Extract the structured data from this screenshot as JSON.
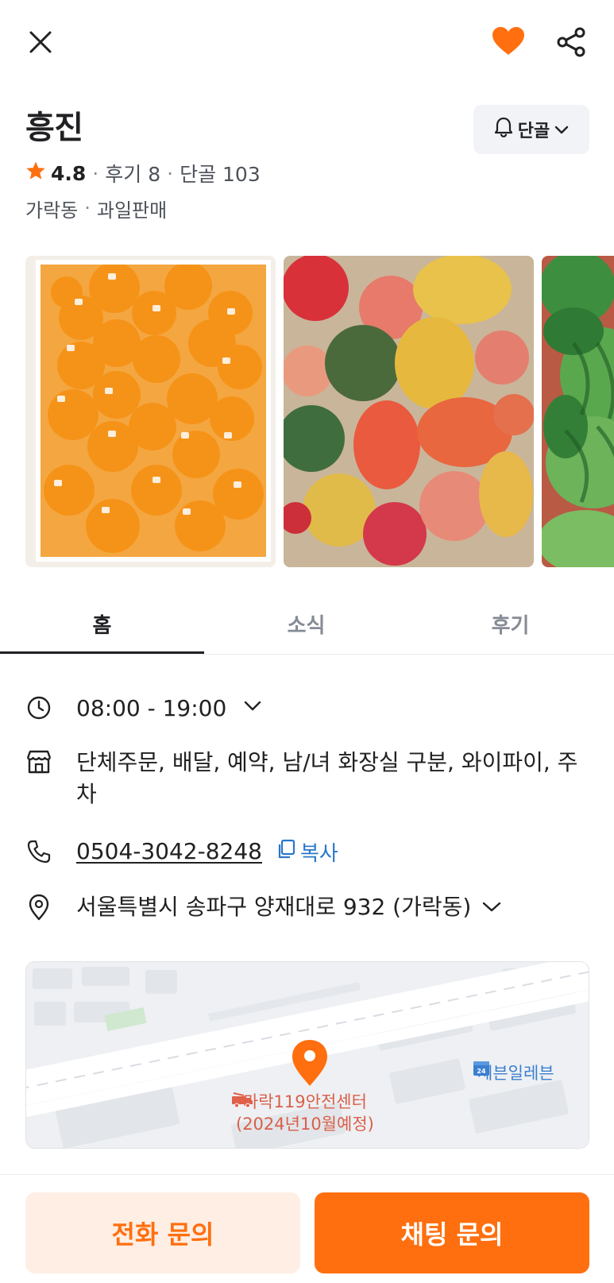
{
  "header": {
    "close_icon": "close-icon",
    "favorite_icon": "heart-icon",
    "share_icon": "share-icon",
    "favorite_color": "#FF6F0F"
  },
  "store": {
    "name": "흥진",
    "regular_button_label": "단골",
    "rating": "4.8",
    "reviews_label": "후기 8",
    "regulars_label": "단골 103",
    "location": "가락동",
    "category": "과일판매"
  },
  "photos": [
    {
      "subject": "boxed tangerines",
      "icon": "photo"
    },
    {
      "subject": "apples and pears",
      "icon": "photo"
    },
    {
      "subject": "watermelons",
      "icon": "photo"
    }
  ],
  "tabs": [
    {
      "label": "홈",
      "active": true
    },
    {
      "label": "소식",
      "active": false
    },
    {
      "label": "후기",
      "active": false
    }
  ],
  "info": {
    "hours": "08:00 - 19:00",
    "amenities": "단체주문, 배달, 예약, 남/녀 화장실 구분, 와이파이, 주차",
    "phone": "0504-3042-8248",
    "copy_label": "복사",
    "address": "서울특별시 송파구 양재대로 932 (가락동)"
  },
  "map": {
    "poi_store": "세븐일레븐",
    "poi_fire_line1": "가락119안전센터",
    "poi_fire_line2": "(2024년10월예정)",
    "pin_color": "#FF6F0F"
  },
  "actions": {
    "call_label": "전화 문의",
    "chat_label": "채팅 문의",
    "accent_color": "#FF6F0F"
  }
}
